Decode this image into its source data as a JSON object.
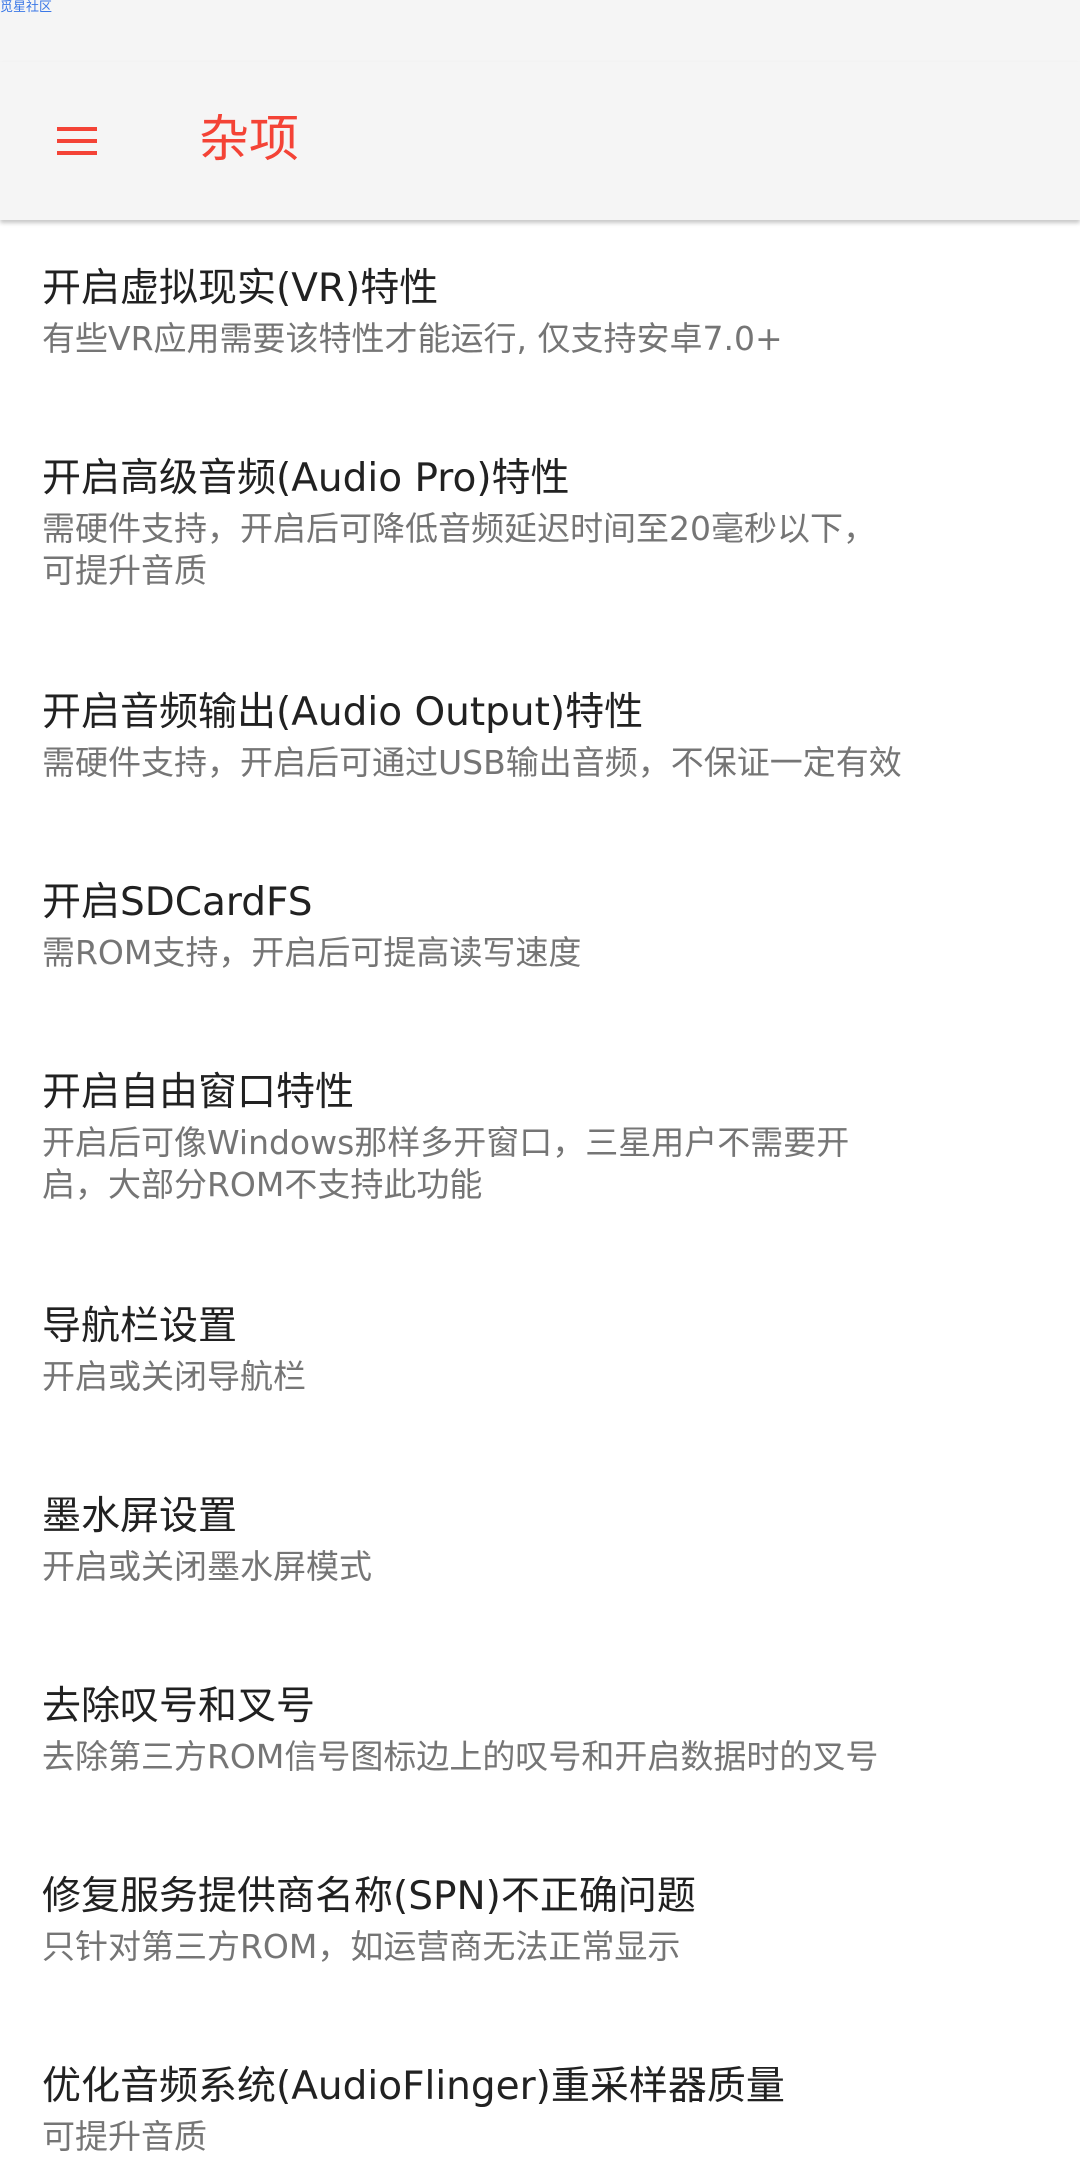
{
  "watermark": "觅星社区",
  "toolbar": {
    "menu_icon": "hamburger-menu-icon",
    "title": "杂项",
    "accent_color": "#f44336"
  },
  "settings": [
    {
      "title": "开启虚拟现实(VR)特性",
      "summary": "有些VR应用需要该特性才能运行, 仅支持安卓7.0+"
    },
    {
      "title": "开启高级音频(Audio Pro)特性",
      "summary": "需硬件支持，开启后可降低音频延迟时间至20毫秒以下，可提升音质"
    },
    {
      "title": "开启音频输出(Audio Output)特性",
      "summary": "需硬件支持，开启后可通过USB输出音频，不保证一定有效"
    },
    {
      "title": "开启SDCardFS",
      "summary": "需ROM支持，开启后可提高读写速度"
    },
    {
      "title": "开启自由窗口特性",
      "summary": "开启后可像Windows那样多开窗口，三星用户不需要开启，大部分ROM不支持此功能"
    },
    {
      "title": "导航栏设置",
      "summary": "开启或关闭导航栏"
    },
    {
      "title": "墨水屏设置",
      "summary": "开启或关闭墨水屏模式"
    },
    {
      "title": "去除叹号和叉号",
      "summary": "去除第三方ROM信号图标边上的叹号和开启数据时的叉号"
    },
    {
      "title": "修复服务提供商名称(SPN)不正确问题",
      "summary": "只针对第三方ROM，如运营商无法正常显示"
    },
    {
      "title": "优化音频系统(AudioFlinger)重采样器质量",
      "summary": "可提升音质"
    }
  ]
}
